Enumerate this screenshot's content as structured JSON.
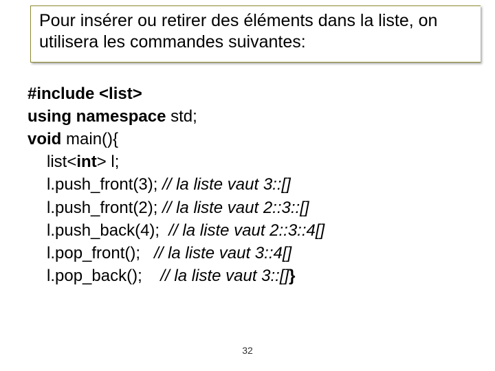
{
  "title": "Pour insérer ou retirer des éléments dans la liste, on utilisera les commandes suivantes:",
  "code": {
    "l1_a": "#include <list>",
    "l2_a": "using namespace ",
    "l2_b": "std;",
    "l3_a": "void ",
    "l3_b": "main(){",
    "l4_a": "list<",
    "l4_b": "int",
    "l4_c": "> l;",
    "l5_a": "l.push_front(3); ",
    "l5_c": "// la liste vaut 3::[]",
    "l6_a": "l.push_front(2); ",
    "l6_c": "// la liste vaut 2::3::[]",
    "l7_a": "l.push_back(4);  ",
    "l7_c": "// la liste vaut 2::3::4[]",
    "l8_a": "l.pop_front();   ",
    "l8_c": "// la liste vaut 3::4[]",
    "l9_a": "l.pop_back();    ",
    "l9_c": "// la liste vaut 3::[]",
    "l9_end": "}"
  },
  "page": "32"
}
